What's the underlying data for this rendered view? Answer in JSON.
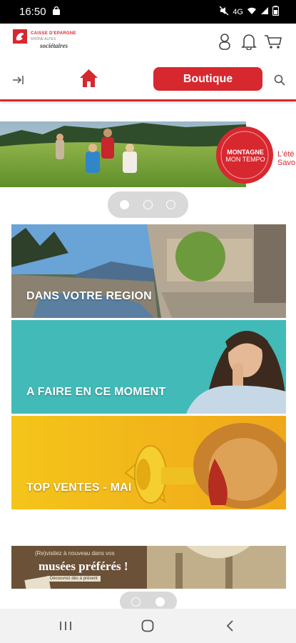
{
  "status_bar": {
    "time": "16:50",
    "network": "4G",
    "icons": [
      "shopping-bag-icon",
      "mute-icon",
      "wifi-icon",
      "signal-icon",
      "battery-icon"
    ]
  },
  "header": {
    "logo_line1": "CAISSE D'EPARGNE",
    "logo_line2": "RHÔNE ALPES",
    "logo_line3": "sociétaires",
    "icons": [
      "user-icon",
      "bell-icon",
      "cart-icon"
    ]
  },
  "nav": {
    "boutique_label": "Boutique",
    "icons": [
      "logout-icon",
      "home-icon",
      "search-icon"
    ]
  },
  "hero": {
    "badge_line1": "MONTAGNE",
    "badge_line2": "MON TEMPO",
    "side_text_1": "L'été",
    "side_text_2": "Savo",
    "pager_active_index": 0,
    "pager_count": 3
  },
  "categories": [
    {
      "label": "DANS VOTRE REGION"
    },
    {
      "label": "A FAIRE EN CE MOMENT"
    },
    {
      "label": "TOP VENTES - MAI"
    }
  ],
  "promo_banner": {
    "line1": "(Re)visitez à nouveau dans vos",
    "line2": "musées préférés !",
    "line3": "Découvrez dès à présent"
  },
  "colors": {
    "brand_red": "#d7282f",
    "teal": "#3fb8b5",
    "yellow": "#f5c21b"
  }
}
